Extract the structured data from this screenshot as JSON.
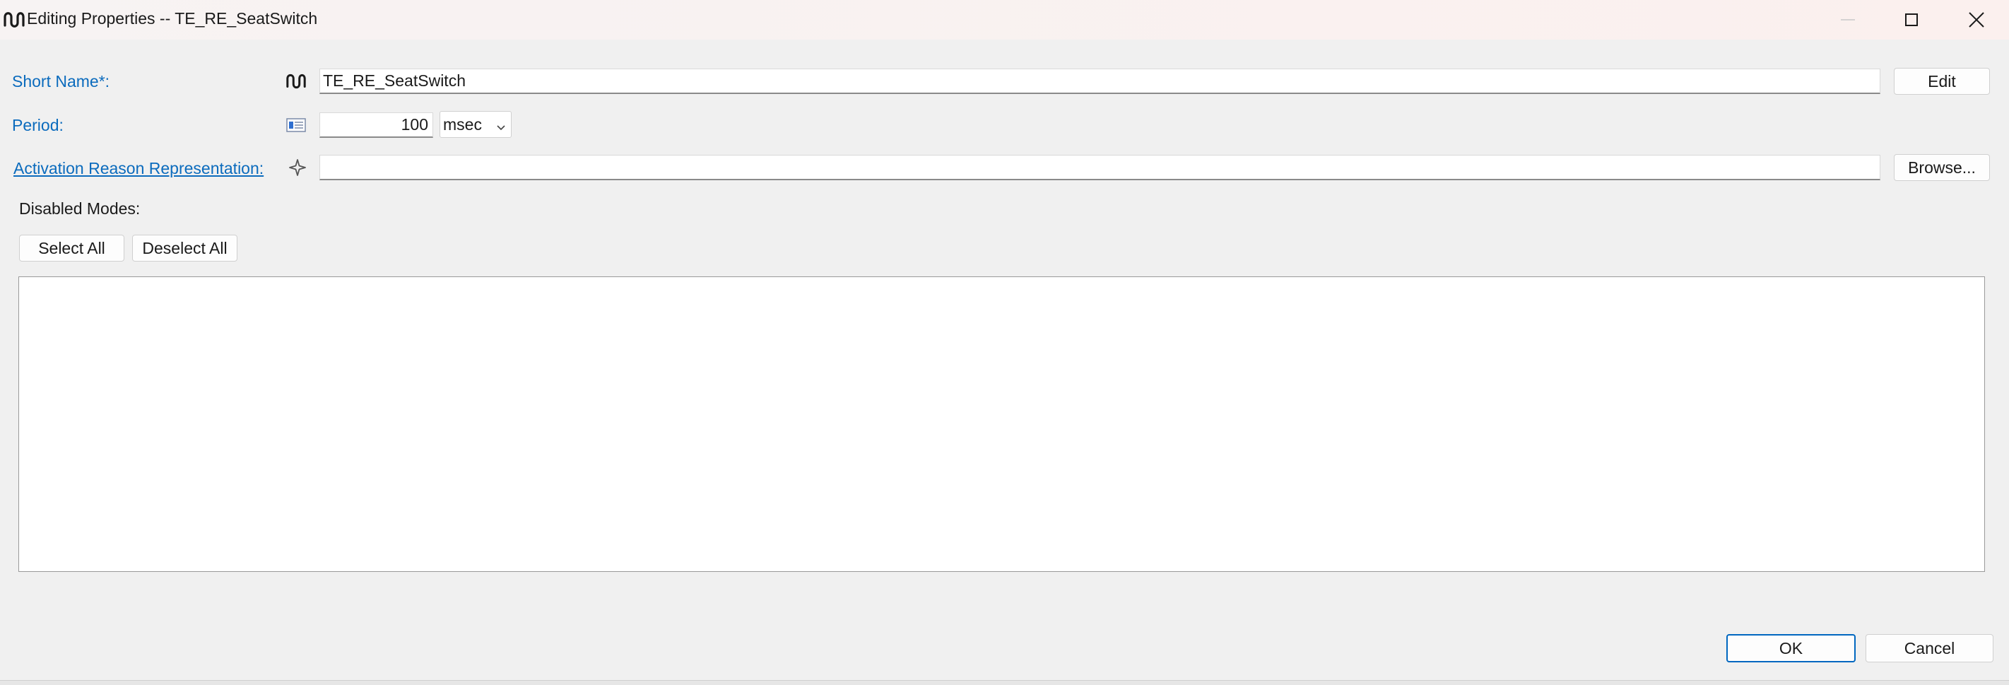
{
  "window": {
    "title": "Editing Properties -- TE_RE_SeatSwitch",
    "icons": {
      "app": "timing-event-icon",
      "minimize": "minimize-icon",
      "maximize": "maximize-icon",
      "close": "close-icon"
    }
  },
  "short_name": {
    "label": "Short Name*:",
    "icon": "timing-event-icon",
    "value": "TE_RE_SeatSwitch",
    "edit_label": "Edit"
  },
  "period": {
    "label": "Period:",
    "icon": "numeric-field-icon",
    "value": "100",
    "unit": "msec"
  },
  "activation_reason": {
    "label": "Activation Reason Representation:",
    "icon": "sparkle-icon",
    "value": "",
    "browse_label": "Browse..."
  },
  "disabled_modes": {
    "label": "Disabled Modes:",
    "select_all_label": "Select All",
    "deselect_all_label": "Deselect All",
    "items": []
  },
  "footer": {
    "ok_label": "OK",
    "cancel_label": "Cancel"
  },
  "colors": {
    "label_link": "#0b6bbd",
    "primary_border": "#0067c0",
    "background": "#f0f0f0"
  }
}
